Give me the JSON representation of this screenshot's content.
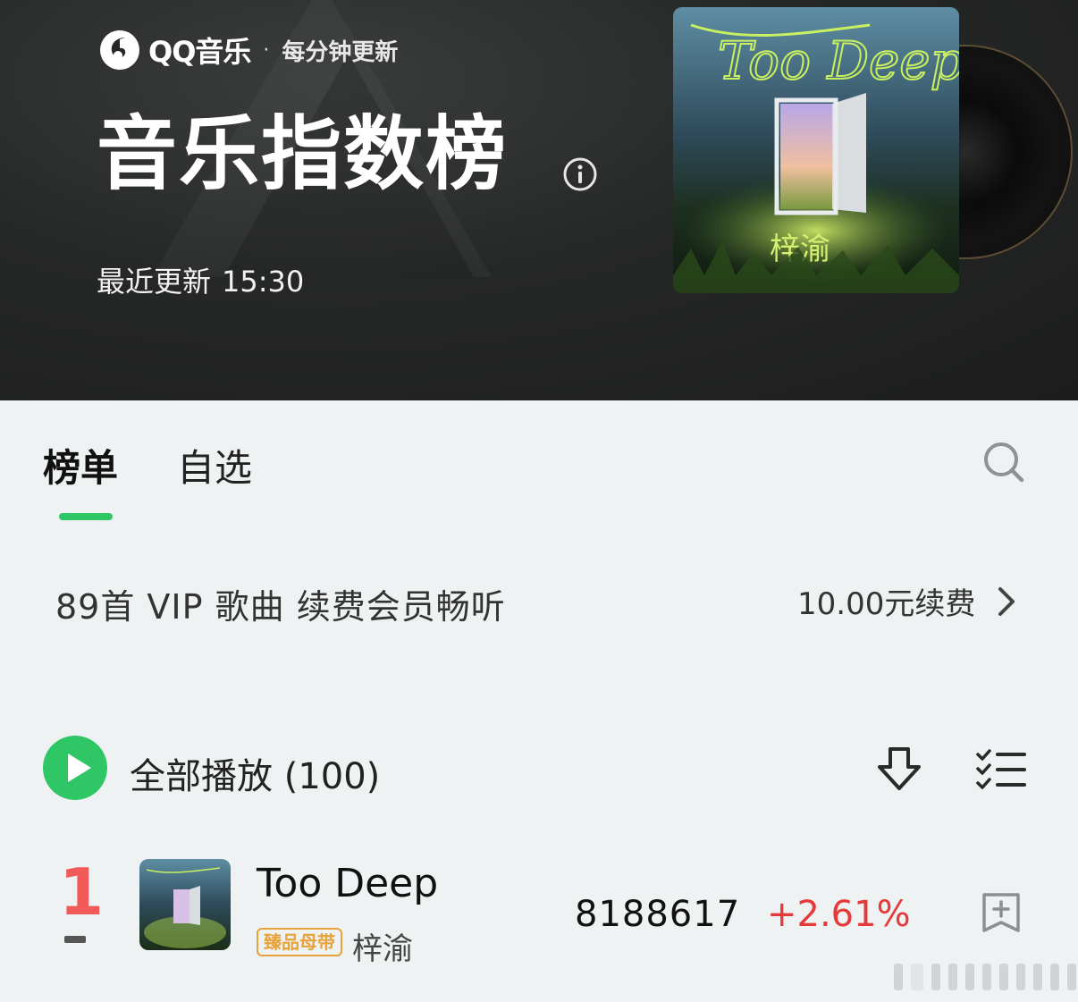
{
  "header": {
    "brand_name": "QQ音乐",
    "brand_dot": "·",
    "brand_tag": "每分钟更新",
    "title": "音乐指数榜",
    "update_label": "最近更新",
    "update_time": "15:30"
  },
  "cover": {
    "title_script": "Too Deep",
    "artist_script": "梓渝"
  },
  "tabs": [
    {
      "label": "榜单",
      "active": true
    },
    {
      "label": "自选",
      "active": false
    }
  ],
  "vip": {
    "text": "89首 VIP 歌曲 续费会员畅听",
    "action": "10.00元续费"
  },
  "play_all": {
    "label": "全部播放",
    "count": "(100)"
  },
  "songs": [
    {
      "rank": "1",
      "title": "Too Deep",
      "badge": "臻品母带",
      "artist": "梓渝",
      "index": "8188617",
      "change": "+2.61%",
      "change_color": "#e63939"
    }
  ],
  "colors": {
    "accent": "#2fc766",
    "rank_top": "#f25a5a",
    "badge": "#e8a23a"
  }
}
